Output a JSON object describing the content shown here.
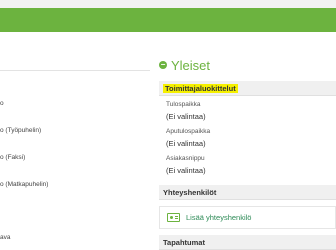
{
  "left_column": {
    "items": [
      "o",
      "o (Työpuhelin)",
      "o (Faksi)",
      "o (Matkapuhelin)",
      "ava"
    ]
  },
  "section": {
    "title": "Yleiset",
    "icon": "minus-circle-icon"
  },
  "supplier_classes": {
    "header": "Toimittajaluokittelut",
    "fields": [
      {
        "label": "Tulospaikka",
        "value": "(Ei valintaa)"
      },
      {
        "label": "Aputulospaikka",
        "value": "(Ei valintaa)"
      },
      {
        "label": "Asiakasnippu",
        "value": "(Ei valintaa)"
      }
    ]
  },
  "contacts": {
    "header": "Yhteyshenkilöt",
    "add_label": "Lisää yhteyshenkilö",
    "add_icon": "contact-card-icon"
  },
  "events": {
    "header": "Tapahtumat"
  },
  "colors": {
    "brand_green": "#6cb33f",
    "highlight": "#f5f000"
  }
}
